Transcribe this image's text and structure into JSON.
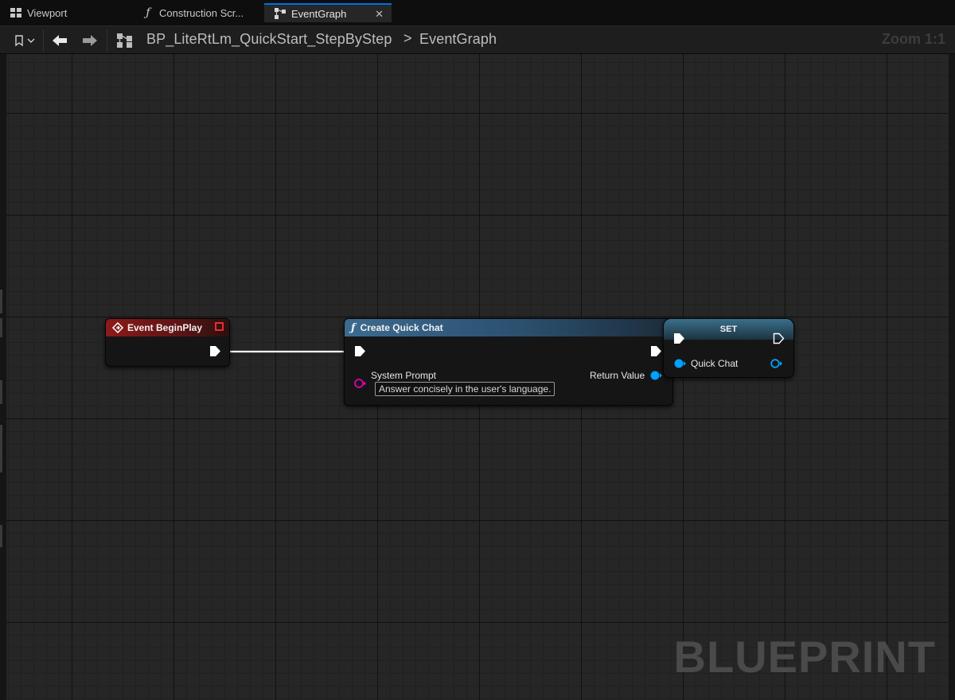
{
  "tabs": [
    {
      "label": "Viewport",
      "icon": "viewport-grid-icon",
      "active": false
    },
    {
      "label": "Construction Scr...",
      "icon": "function-icon",
      "active": false
    },
    {
      "label": "EventGraph",
      "icon": "graph-icon",
      "active": true,
      "close": "✕"
    }
  ],
  "toolbar": {
    "breadcrumb_blueprint": "BP_LiteRtLm_QuickStart_StepByStep",
    "breadcrumb_separator": ">",
    "breadcrumb_graph": "EventGraph",
    "zoom": "Zoom 1:1"
  },
  "graph": {
    "watermark": "BLUEPRINT",
    "nodes": {
      "begin_play": {
        "title": "Event BeginPlay"
      },
      "create_quick_chat": {
        "title": "Create Quick Chat",
        "input_label": "System Prompt",
        "input_value": "Answer concisely in the user's language.",
        "output_label": "Return Value"
      },
      "set": {
        "title": "SET",
        "variable": "Quick Chat"
      }
    }
  },
  "colors": {
    "event_header": "#8c1a1a",
    "function_header": "#3c6a8f",
    "object_pin": "#00a0ff",
    "string_pin": "#e000b0",
    "tab_accent": "#0070e0"
  }
}
